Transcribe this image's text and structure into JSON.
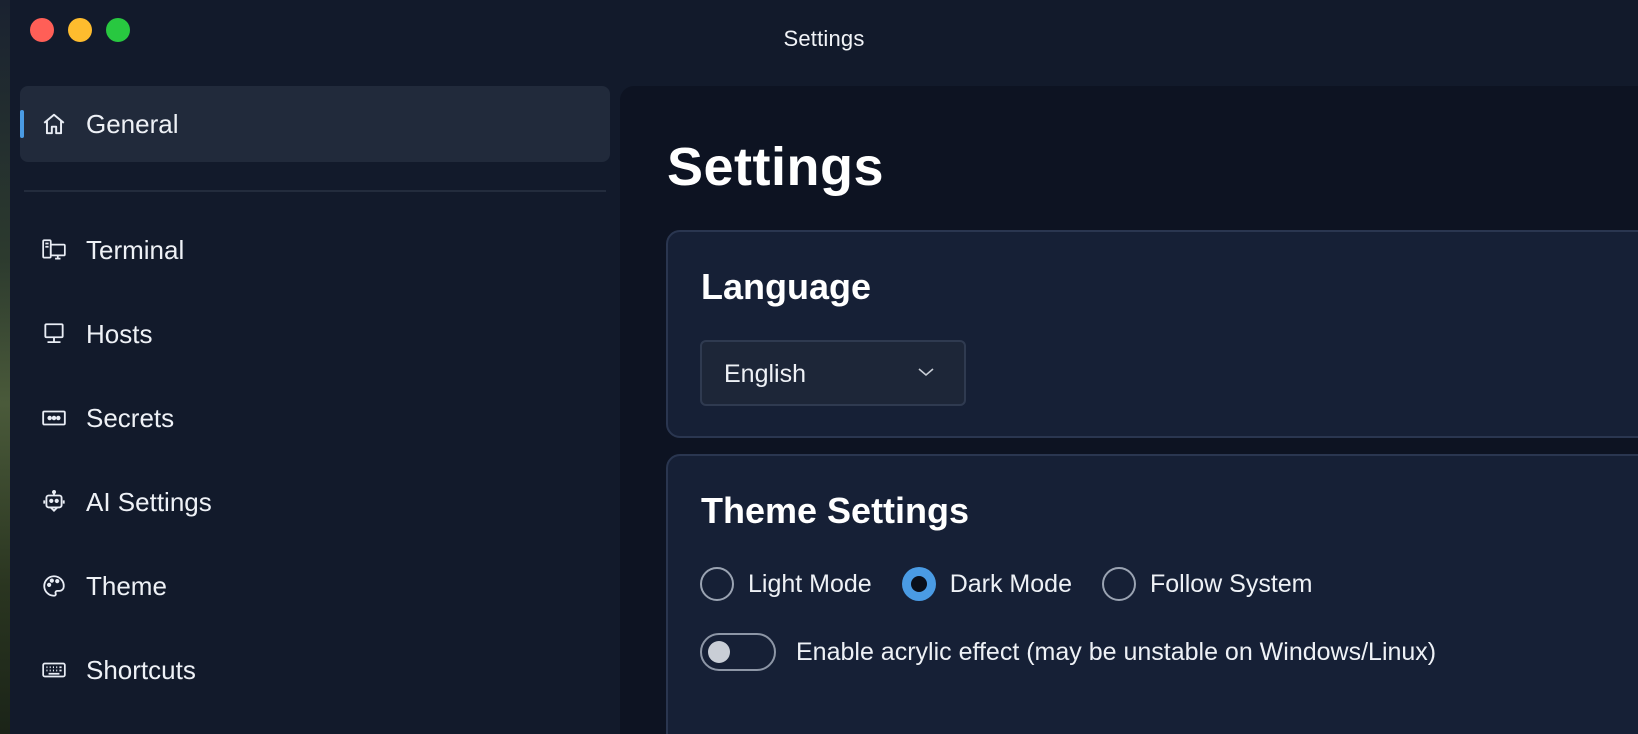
{
  "window": {
    "title": "Settings"
  },
  "sidebar": {
    "items": [
      {
        "label": "General",
        "icon": "home-icon",
        "active": true
      },
      {
        "label": "Terminal",
        "icon": "terminal-icon",
        "active": false
      },
      {
        "label": "Hosts",
        "icon": "monitor-icon",
        "active": false
      },
      {
        "label": "Secrets",
        "icon": "secrets-icon",
        "active": false
      },
      {
        "label": "AI Settings",
        "icon": "robot-icon",
        "active": false
      },
      {
        "label": "Theme",
        "icon": "palette-icon",
        "active": false
      },
      {
        "label": "Shortcuts",
        "icon": "keyboard-icon",
        "active": false
      }
    ]
  },
  "main": {
    "title": "Settings",
    "language": {
      "title": "Language",
      "selected": "English"
    },
    "theme": {
      "title": "Theme Settings",
      "options": [
        {
          "label": "Light Mode",
          "checked": false
        },
        {
          "label": "Dark Mode",
          "checked": true
        },
        {
          "label": "Follow System",
          "checked": false
        }
      ],
      "acrylic": {
        "label": "Enable acrylic effect (may be unstable on Windows/Linux)",
        "enabled": false
      }
    }
  },
  "colors": {
    "accent": "#4a9be4",
    "sidebar_bg": "#121a2b",
    "main_bg": "#0d1322",
    "card_bg": "#162036",
    "close": "#ff5f57",
    "minimize": "#febc2e",
    "maximize": "#28c840"
  }
}
